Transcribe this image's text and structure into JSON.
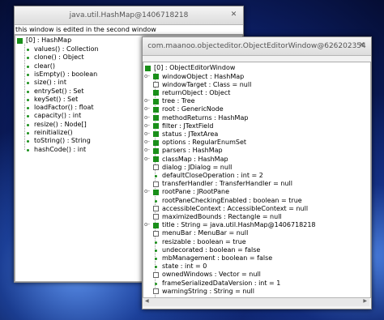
{
  "win1": {
    "title": "java.util.HashMap@1406718218",
    "caption": "this window is edited in the second window",
    "close_glyph": "✕",
    "root": "[0] : HashMap",
    "items": [
      "values() : Collection",
      "clone() : Object",
      "clear()",
      "isEmpty() : boolean",
      "size() : int",
      "entrySet() : Set",
      "keySet() : Set",
      "loadFactor() : float",
      "capacity() : int",
      "resize() : Node[]",
      "reinitialize()",
      "toString() : String",
      "hashCode() : int"
    ]
  },
  "win2": {
    "title": "com.maanoo.objecteditor.ObjectEditorWindow@626202354",
    "close_glyph": "✕",
    "root": "[0] : ObjectEditorWindow",
    "handle_glyph": "o-",
    "items": [
      {
        "text": "windowObject : HashMap",
        "icon": "filled",
        "handle": true
      },
      {
        "text": "windowTarget : Class = null",
        "icon": "empty",
        "handle": false
      },
      {
        "text": "returnObject : Object",
        "icon": "filled",
        "handle": false
      },
      {
        "text": "tree : Tree",
        "icon": "filled",
        "handle": true
      },
      {
        "text": "root : GenericNode",
        "icon": "filled",
        "handle": true
      },
      {
        "text": "methodReturns : HashMap",
        "icon": "filled",
        "handle": true
      },
      {
        "text": "filter : JTextField",
        "icon": "filled",
        "handle": true
      },
      {
        "text": "status : JTextArea",
        "icon": "filled",
        "handle": true
      },
      {
        "text": "options : RegularEnumSet",
        "icon": "filled",
        "handle": true
      },
      {
        "text": "parsers : HashMap",
        "icon": "filled",
        "handle": true
      },
      {
        "text": "classMap : HashMap",
        "icon": "filled",
        "handle": true
      },
      {
        "text": "dialog : JDialog = null",
        "icon": "empty",
        "handle": false
      },
      {
        "text": "defaultCloseOperation : int = 2",
        "icon": "dot",
        "handle": false
      },
      {
        "text": "transferHandler : TransferHandler = null",
        "icon": "empty",
        "handle": false
      },
      {
        "text": "rootPane : JRootPane",
        "icon": "filled",
        "handle": true
      },
      {
        "text": "rootPaneCheckingEnabled : boolean = true",
        "icon": "dot",
        "handle": false
      },
      {
        "text": "accessibleContext : AccessibleContext = null",
        "icon": "empty",
        "handle": false
      },
      {
        "text": "maximizedBounds : Rectangle = null",
        "icon": "empty",
        "handle": false
      },
      {
        "text": "title : String = java.util.HashMap@1406718218",
        "icon": "filled",
        "handle": true
      },
      {
        "text": "menuBar : MenuBar = null",
        "icon": "empty",
        "handle": false
      },
      {
        "text": "resizable : boolean = true",
        "icon": "dot",
        "handle": false
      },
      {
        "text": "undecorated : boolean = false",
        "icon": "dot",
        "handle": false
      },
      {
        "text": "mbManagement : boolean = false",
        "icon": "dot",
        "handle": false
      },
      {
        "text": "state : int = 0",
        "icon": "dot",
        "handle": false
      },
      {
        "text": "ownedWindows : Vector = null",
        "icon": "empty",
        "handle": false
      },
      {
        "text": "frameSerializedDataVersion : int = 1",
        "icon": "dot",
        "handle": false
      },
      {
        "text": "warningString : String = null",
        "icon": "empty",
        "handle": false
      }
    ],
    "scroll_left_glyph": "◀",
    "scroll_right_glyph": "▶"
  }
}
